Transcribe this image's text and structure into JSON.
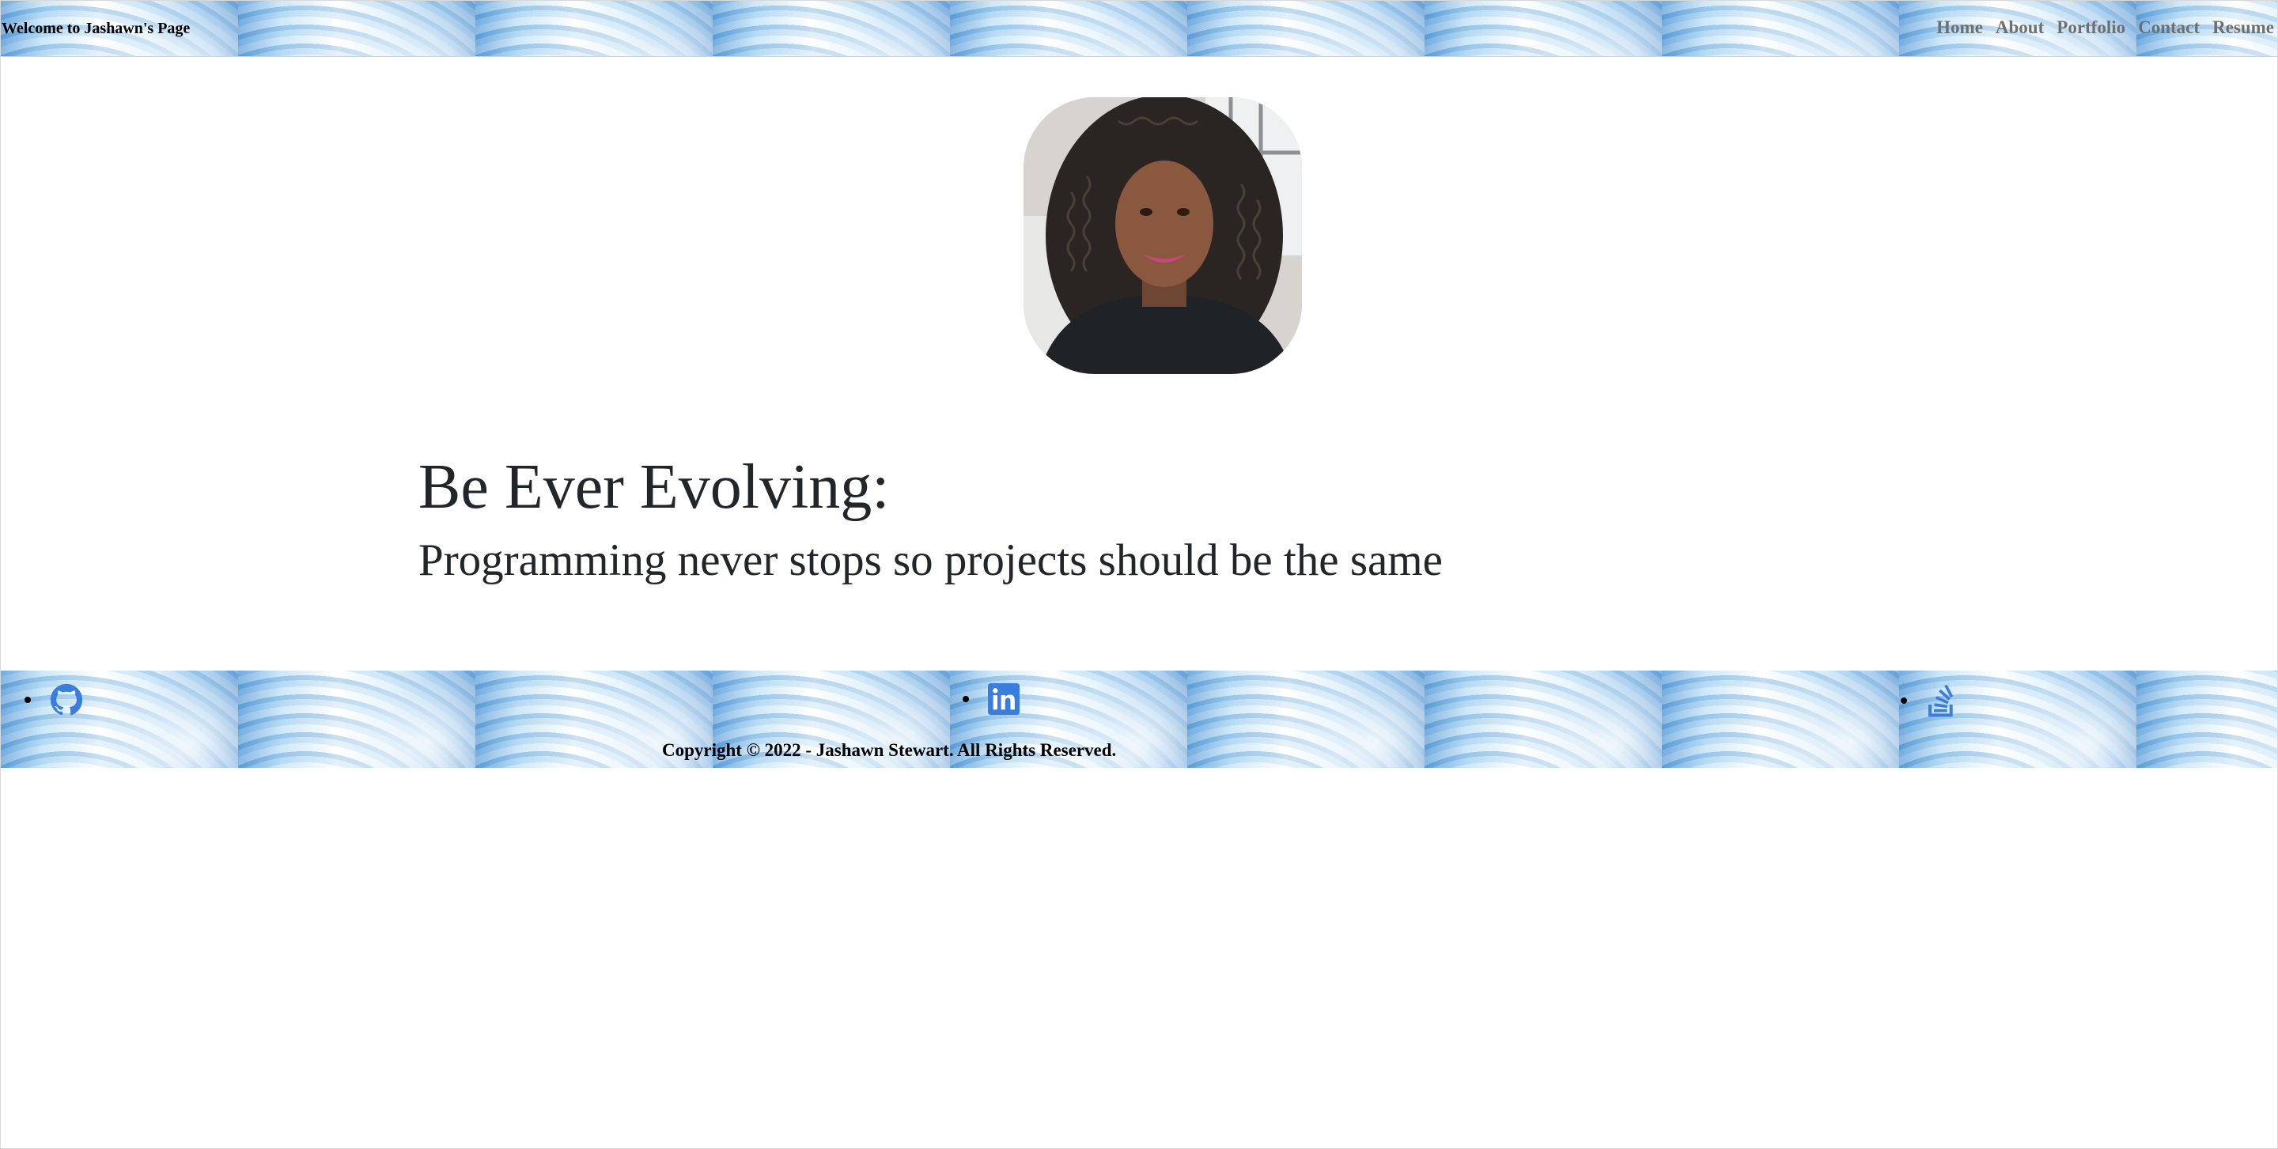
{
  "header": {
    "brand": "Welcome to Jashawn's Page",
    "nav": [
      "Home",
      "About",
      "Portfolio",
      "Contact",
      "Resume"
    ]
  },
  "profile": {
    "avatar_alt": "Profile photo of Jashawn Stewart"
  },
  "hero": {
    "title": "Be Ever Evolving:",
    "subtitle": "Programming never stops so projects should be the same"
  },
  "footer": {
    "social": [
      {
        "icon": "github-icon"
      },
      {
        "icon": "linkedin-icon"
      },
      {
        "icon": "stack-overflow-icon"
      }
    ],
    "copyright": "Copyright © 2022 - Jashawn Stewart. All Rights Reserved."
  },
  "colors": {
    "icon_blue": "#3b7ddd",
    "nav_gray": "#6f6f6f",
    "text_dark": "#222629"
  }
}
